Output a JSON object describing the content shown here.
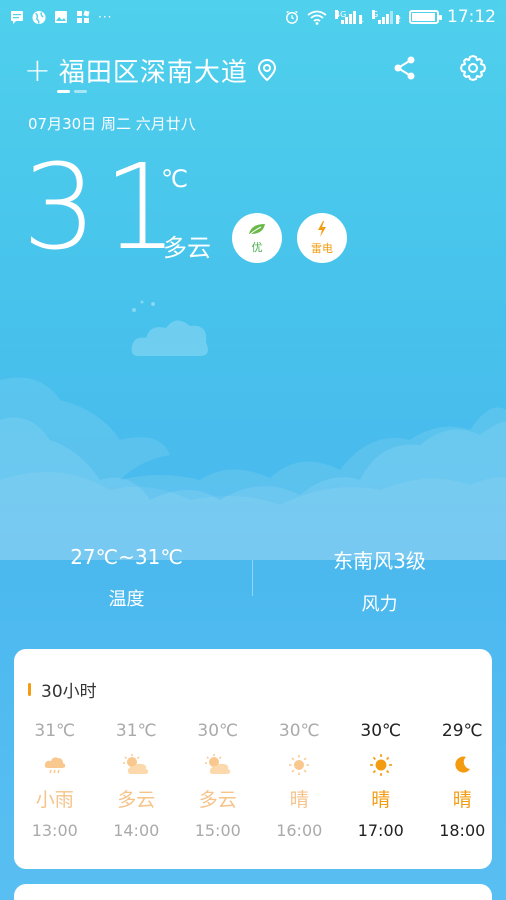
{
  "status_bar": {
    "time": "17:12",
    "network_1": "4G",
    "network_2": "G",
    "sim_1": "1",
    "sim_2": "2",
    "battery_level": 0.9,
    "overflow": "···"
  },
  "header": {
    "city": "福田区深南大道"
  },
  "date_line": "07月30日  周二  六月廿八",
  "current": {
    "temperature": "31",
    "unit": "℃",
    "condition": "多云",
    "aqi_label": "优",
    "warning_label": "雷电"
  },
  "stats": {
    "temp_range": "27℃~31℃",
    "temp_label": "温度",
    "wind": "东南风3级",
    "wind_label": "风力"
  },
  "forecast_card": {
    "title": "30小时",
    "hours": [
      {
        "temp": "31℃",
        "cond": "小雨",
        "time": "13:00",
        "icon": "rain-cloud-icon"
      },
      {
        "temp": "31℃",
        "cond": "多云",
        "time": "14:00",
        "icon": "partly-cloudy-icon"
      },
      {
        "temp": "30℃",
        "cond": "多云",
        "time": "15:00",
        "icon": "partly-cloudy-icon"
      },
      {
        "temp": "30℃",
        "cond": "晴",
        "time": "16:00",
        "icon": "sun-icon"
      },
      {
        "temp": "30℃",
        "cond": "晴",
        "time": "17:00",
        "icon": "sun-icon"
      },
      {
        "temp": "29℃",
        "cond": "晴",
        "time": "18:00",
        "icon": "moon-icon"
      }
    ]
  },
  "colors": {
    "accent_orange": "#f39c12",
    "aqi_green": "#4caf50"
  }
}
